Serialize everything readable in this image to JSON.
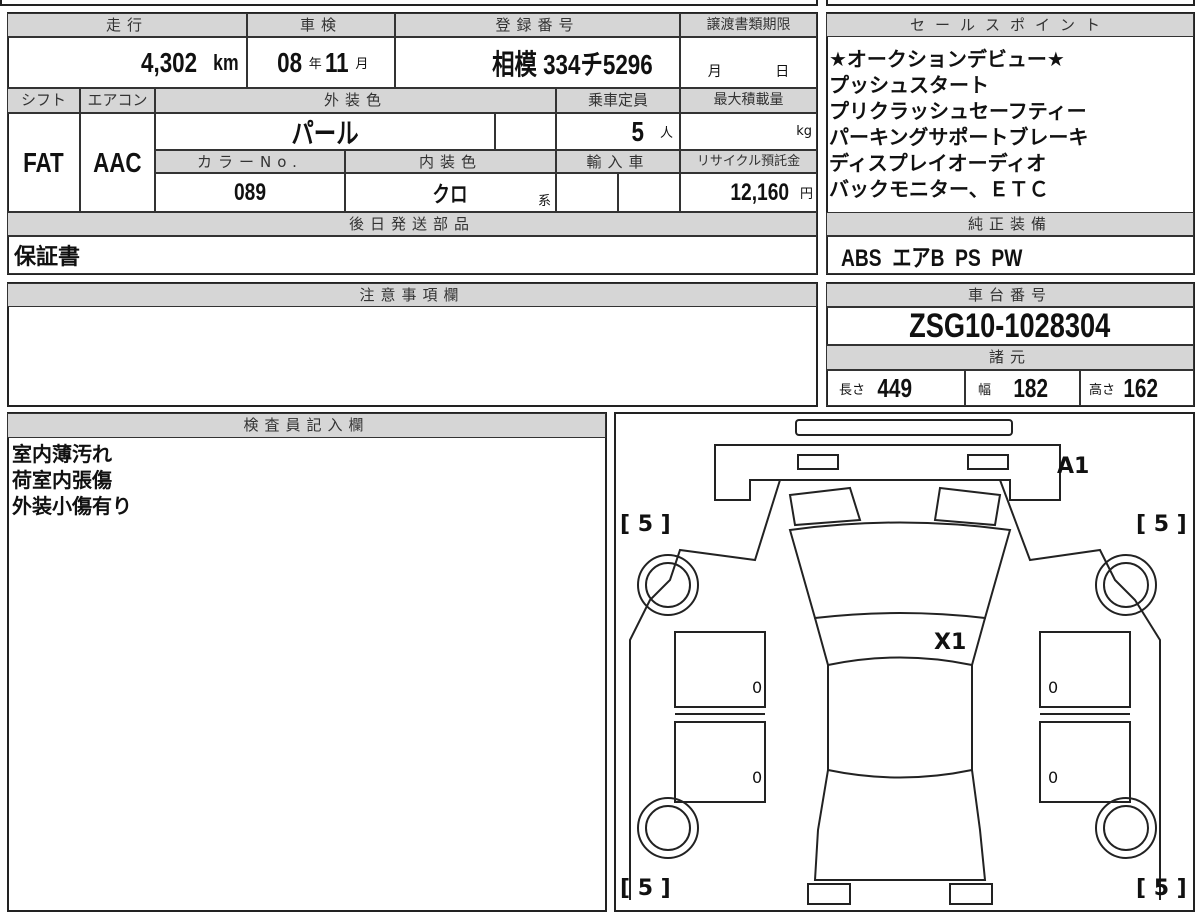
{
  "headers": {
    "mileage": "走行",
    "inspection": "車検",
    "registration": "登録番号",
    "transfer_deadline": "譲渡書類期限",
    "shift": "シフト",
    "aircon": "エアコン",
    "exterior_color": "外装色",
    "capacity": "乗車定員",
    "max_load": "最大積載量",
    "color_no": "カラーNo.",
    "interior_color": "内装色",
    "import": "輸入車",
    "recycle": "リサイクル預託金",
    "later_parts": "後日発送部品",
    "sales_points": "セールスポイント",
    "standard_equipment": "純正装備",
    "notes": "注意事項欄",
    "chassis_no": "車台番号",
    "specs": "諸元",
    "inspector": "検査員記入欄"
  },
  "values": {
    "mileage": "4,302",
    "mileage_unit": "km",
    "inspection_year": "08",
    "year_unit": "年",
    "inspection_month": "11",
    "month_unit": "月",
    "registration": "相模 334チ5296",
    "transfer_month": "月",
    "transfer_day": "日",
    "shift": "FAT",
    "aircon": "AAC",
    "exterior_color": "パール",
    "capacity": "5",
    "capacity_unit": "人",
    "max_load_unit": "kg",
    "color_no": "089",
    "interior_color": "クロ",
    "interior_suffix": "系",
    "recycle": "12,160",
    "recycle_unit": "円",
    "later_parts": "保証書",
    "standard_equipment": "ABS  エアB  PS  PW",
    "chassis_no": "ZSG10-1028304",
    "length_label": "長さ",
    "length": "449",
    "width_label": "幅",
    "width": "182",
    "height_label": "高さ",
    "height": "162"
  },
  "sales_points": [
    "★オークションデビュー★",
    "プッシュスタート",
    "プリクラッシュセーフティー",
    "パーキングサポートブレーキ",
    "ディスプレイオーディオ",
    "バックモニター、ＥＴＣ"
  ],
  "inspector_notes": [
    "室内薄汚れ",
    "荷室内張傷",
    "外装小傷有り"
  ],
  "diagram": {
    "front_mark": "A1",
    "windshield_mark": "X1",
    "tire_fl": "[ 5 ]",
    "tire_fr": "[ 5 ]",
    "tire_rl": "[ 5 ]",
    "tire_rr": "[ 5 ]",
    "door_mark": "0"
  }
}
